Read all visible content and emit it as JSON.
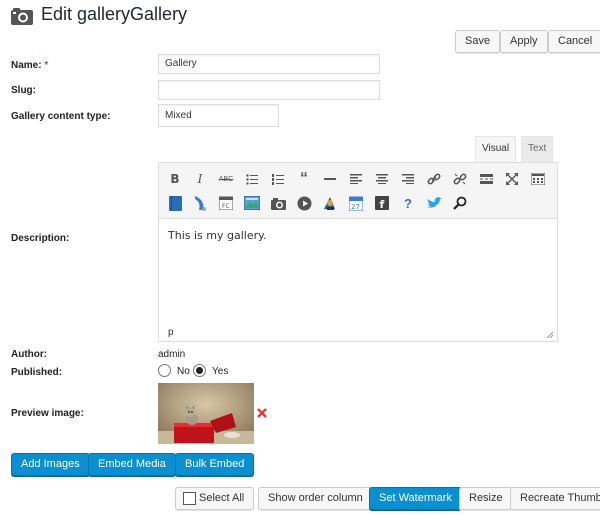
{
  "header": {
    "title": "Edit galleryGallery",
    "icon": "camera-icon",
    "actions": {
      "save": "Save",
      "apply": "Apply",
      "cancel": "Cancel"
    }
  },
  "form": {
    "name": {
      "label": "Name:",
      "required_mark": "*",
      "value": "Gallery"
    },
    "slug": {
      "label": "Slug:",
      "value": ""
    },
    "content_type": {
      "label": "Gallery content type:",
      "value": "Mixed"
    },
    "description": {
      "label": "Description:",
      "tabs": {
        "visual": "Visual",
        "text": "Text"
      },
      "content": "This is my gallery.",
      "status_path": "p",
      "toolbar_icons": [
        "bold-icon",
        "italic-icon",
        "strikethrough-icon",
        "bullet-list-icon",
        "numbered-list-icon",
        "blockquote-icon",
        "horizontal-rule-icon",
        "align-left-icon",
        "align-center-icon",
        "align-right-icon",
        "link-icon",
        "unlink-icon",
        "read-more-icon",
        "fullscreen-icon",
        "toolbar-toggle-icon",
        "book-icon",
        "shortcode-icon",
        "calendar-icon",
        "image-icon",
        "camera-icon",
        "video-icon",
        "wizard-icon",
        "event-calendar-icon",
        "facebook-icon",
        "help-icon",
        "twitter-icon",
        "search-icon"
      ]
    },
    "author": {
      "label": "Author:",
      "value": "admin"
    },
    "published": {
      "label": "Published:",
      "options": [
        "No",
        "Yes"
      ],
      "selected": "Yes"
    },
    "preview": {
      "label": "Preview image:",
      "remove_icon": "close-icon"
    }
  },
  "media_actions": {
    "add_images": "Add Images",
    "embed_media": "Embed Media",
    "bulk_embed": "Bulk Embed"
  },
  "bottom_actions": {
    "select_all": "Select All",
    "show_order_column": "Show order column",
    "set_watermark": "Set Watermark",
    "resize": "Resize",
    "recreate_thumbnails": "Recreate Thumbnails"
  },
  "colors": {
    "primary": "#0a8fd0",
    "remove": "#dd3d36"
  }
}
